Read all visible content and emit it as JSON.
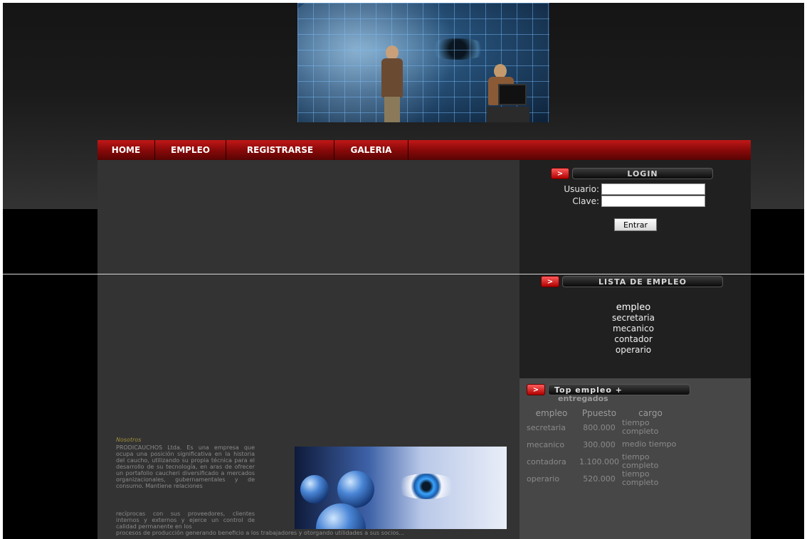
{
  "nav": {
    "items": [
      {
        "label": "HOME"
      },
      {
        "label": "EMPLEO"
      },
      {
        "label": "REGISTRARSE"
      },
      {
        "label": "GALERIA"
      }
    ]
  },
  "login": {
    "arrow": ">",
    "title": "LOGIN",
    "user_label": "Usuario:",
    "pass_label": "Clave:",
    "user_value": "",
    "pass_value": "",
    "submit_label": "Entrar"
  },
  "job_list": {
    "arrow": ">",
    "title": "LISTA DE EMPLEO",
    "heading": "empleo",
    "items": [
      "secretaria",
      "mecanico",
      "contador",
      "operario"
    ]
  },
  "top_jobs": {
    "arrow": ">",
    "title": "Top empleo +",
    "subtitle": "entregados",
    "columns": [
      "empleo",
      "Ppuesto",
      "cargo"
    ],
    "rows": [
      {
        "empleo": "secretaria",
        "puesto": "800.000",
        "cargo": "tiempo completo"
      },
      {
        "empleo": "mecanico",
        "puesto": "300.000",
        "cargo": "medio tiempo"
      },
      {
        "empleo": "contadora",
        "puesto": "1.100.000",
        "cargo": "tiempo completo"
      },
      {
        "empleo": "operario",
        "puesto": "520.000",
        "cargo": "tiempo completo"
      }
    ]
  },
  "about": {
    "title": "Nosotros",
    "text1": "PRODICAUCHOS Ltda. Es una empresa que ocupa una posición significativa en la historia del caucho, utilizando su propia técnica para el desarrollo de su tecnología, en aras de ofrecer un portafolio caucheri diversificado a mercados organizacionales, gubernamentales y de consumo. Mantiene relaciones",
    "text2": "recíprocas con sus proveedores, clientes internos y externos y ejerce un control de calidad permanente en los",
    "text3": "procesos de producción generando beneficio a los trabajadores y otorgando utilidades a sus socios..."
  },
  "colors": {
    "nav_red": "#8e0a0a",
    "content_bg": "#333333",
    "sidebar_bg": "#202020",
    "sidebar_lower_bg": "#474747"
  }
}
